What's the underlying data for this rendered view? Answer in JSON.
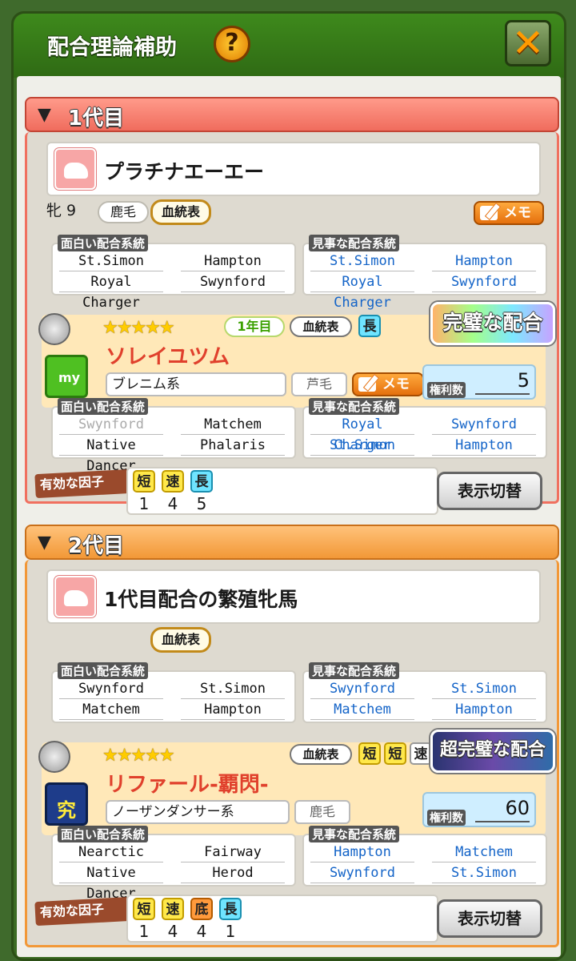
{
  "header": {
    "title": "配合理論補助",
    "help_glyph": "?",
    "close_glyph": "✕"
  },
  "gen1": {
    "label": "1代目",
    "horse": {
      "name": "プラチナエーエー",
      "sex_age": "牝 9",
      "coat": "鹿毛",
      "pedigree_label": "血統表",
      "memo_label": "メモ",
      "interesting": {
        "title": "面白い配合系統",
        "cells": [
          "St.Simon",
          "Hampton",
          "Royal Charger",
          "Swynford"
        ]
      },
      "excellent": {
        "title": "見事な配合系統",
        "cells": [
          "St.Simon",
          "Hampton",
          "Royal Charger",
          "Swynford"
        ]
      }
    },
    "mate": {
      "stars": "★★★★★",
      "year": "1年目",
      "pedigree_label": "血統表",
      "trait": "長",
      "name": "ソレイユツム",
      "lineage": "ブレニム系",
      "coat": "芦毛",
      "memo_label": "メモ",
      "badge": "完璧な配合",
      "rights_label": "権利数",
      "rights_value": "5",
      "interesting": {
        "title": "面白い配合系統",
        "cells": [
          "Swynford",
          "Matchem",
          "Native Dancer",
          "Phalaris"
        ]
      },
      "excellent": {
        "title": "見事な配合系統",
        "cells": [
          "Royal Charger",
          "Swynford",
          "St.Simon",
          "Hampton"
        ]
      }
    },
    "factors": {
      "label": "有効な因子",
      "tags": [
        "短",
        "速",
        "長"
      ],
      "values": [
        "1",
        "4",
        "5"
      ]
    },
    "toggle_label": "表示切替"
  },
  "gen2": {
    "label": "2代目",
    "horse": {
      "name": "1代目配合の繁殖牝馬",
      "pedigree_label": "血統表",
      "interesting": {
        "title": "面白い配合系統",
        "cells": [
          "Swynford",
          "St.Simon",
          "Matchem",
          "Hampton"
        ]
      },
      "excellent": {
        "title": "見事な配合系統",
        "cells": [
          "Swynford",
          "St.Simon",
          "Matchem",
          "Hampton"
        ]
      }
    },
    "mate": {
      "stars": "★★★★★",
      "pedigree_label": "血統表",
      "traits": [
        "短",
        "短",
        "速"
      ],
      "name": "リファール-覇閃-",
      "lineage": "ノーザンダンサー系",
      "coat": "鹿毛",
      "badge": "超完璧な配合",
      "rights_label": "権利数",
      "rights_value": "60",
      "interesting": {
        "title": "面白い配合系統",
        "cells": [
          "Nearctic",
          "Fairway",
          "Native Dancer",
          "Herod"
        ]
      },
      "excellent": {
        "title": "見事な配合系統",
        "cells": [
          "Hampton",
          "Matchem",
          "Swynford",
          "St.Simon"
        ]
      }
    },
    "factors": {
      "label": "有効な因子",
      "tags": [
        "短",
        "速",
        "底",
        "長"
      ],
      "values": [
        "1",
        "4",
        "4",
        "1"
      ]
    },
    "toggle_label": "表示切替"
  }
}
